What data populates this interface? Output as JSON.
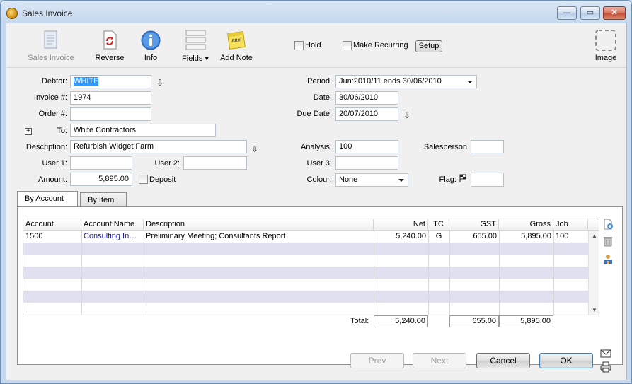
{
  "window": {
    "title": "Sales Invoice",
    "controls": {
      "minimize": "—",
      "maximize": "▭",
      "close": "✕"
    }
  },
  "toolbar": {
    "items": [
      {
        "label": "Sales Invoice",
        "icon": "document-icon",
        "disabled": true
      },
      {
        "label": "Reverse",
        "icon": "reverse-icon"
      },
      {
        "label": "Info",
        "icon": "info-icon"
      },
      {
        "label": "Fields",
        "icon": "fields-icon"
      },
      {
        "label": "Add Note",
        "icon": "note-icon"
      }
    ],
    "hold_label": "Hold",
    "recurring_label": "Make Recurring",
    "setup_label": "Setup",
    "image_label": "Image"
  },
  "form": {
    "debtor_label": "Debtor:",
    "debtor_value": "WHITE",
    "invoice_label": "Invoice #:",
    "invoice_value": "1974",
    "order_label": "Order #:",
    "order_value": "",
    "to_label": "To:",
    "to_value": "White Contractors",
    "description_label": "Description:",
    "description_value": "Refurbish Widget Farm",
    "user1_label": "User 1:",
    "user1_value": "",
    "user2_label": "User 2:",
    "user2_value": "",
    "user3_label": "User 3:",
    "user3_value": "",
    "amount_label": "Amount:",
    "amount_value": "5,895.00",
    "deposit_label": "Deposit",
    "period_label": "Period:",
    "period_value": "Jun:2010/11 ends 30/06/2010",
    "date_label": "Date:",
    "date_value": "30/06/2010",
    "due_label": "Due Date:",
    "due_value": "20/07/2010",
    "analysis_label": "Analysis:",
    "analysis_value": "100",
    "salesperson_label": "Salesperson",
    "salesperson_value": "",
    "colour_label": "Colour:",
    "colour_value": "None",
    "flag_label": "Flag:",
    "flag_value": ""
  },
  "tabs": [
    {
      "label": "By Account",
      "active": true
    },
    {
      "label": "By Item",
      "active": false
    }
  ],
  "table": {
    "columns": [
      "Account",
      "Account Name",
      "Description",
      "Net",
      "TC",
      "GST",
      "Gross",
      "Job"
    ],
    "rows": [
      {
        "account": "1500",
        "account_name": "Consulting In…",
        "description": "Preliminary Meeting; Consultants Report",
        "net": "5,240.00",
        "tc": "G",
        "gst": "655.00",
        "gross": "5,895.00",
        "job": "100"
      }
    ],
    "total_label": "Total:",
    "total_net": "5,240.00",
    "total_gst": "655.00",
    "total_gross": "5,895.00"
  },
  "buttons": {
    "prev": "Prev",
    "next": "Next",
    "cancel": "Cancel",
    "ok": "OK"
  },
  "colors": {
    "selection": "#3399ff",
    "stripe": "#e0e0f0",
    "account_name_text": "#1a1a8c"
  }
}
